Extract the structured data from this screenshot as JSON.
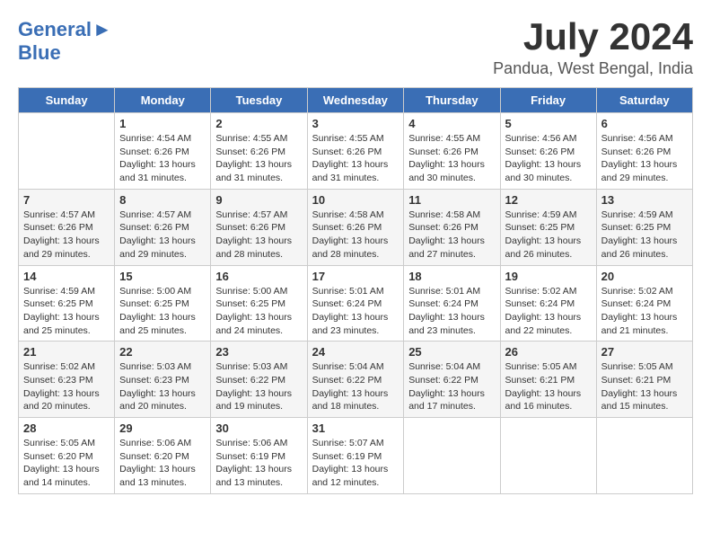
{
  "header": {
    "logo_general": "General",
    "logo_blue": "Blue",
    "month": "July 2024",
    "location": "Pandua, West Bengal, India"
  },
  "calendar": {
    "days_of_week": [
      "Sunday",
      "Monday",
      "Tuesday",
      "Wednesday",
      "Thursday",
      "Friday",
      "Saturday"
    ],
    "weeks": [
      [
        {
          "day": "",
          "info": ""
        },
        {
          "day": "1",
          "info": "Sunrise: 4:54 AM\nSunset: 6:26 PM\nDaylight: 13 hours\nand 31 minutes."
        },
        {
          "day": "2",
          "info": "Sunrise: 4:55 AM\nSunset: 6:26 PM\nDaylight: 13 hours\nand 31 minutes."
        },
        {
          "day": "3",
          "info": "Sunrise: 4:55 AM\nSunset: 6:26 PM\nDaylight: 13 hours\nand 31 minutes."
        },
        {
          "day": "4",
          "info": "Sunrise: 4:55 AM\nSunset: 6:26 PM\nDaylight: 13 hours\nand 30 minutes."
        },
        {
          "day": "5",
          "info": "Sunrise: 4:56 AM\nSunset: 6:26 PM\nDaylight: 13 hours\nand 30 minutes."
        },
        {
          "day": "6",
          "info": "Sunrise: 4:56 AM\nSunset: 6:26 PM\nDaylight: 13 hours\nand 29 minutes."
        }
      ],
      [
        {
          "day": "7",
          "info": "Sunrise: 4:57 AM\nSunset: 6:26 PM\nDaylight: 13 hours\nand 29 minutes."
        },
        {
          "day": "8",
          "info": "Sunrise: 4:57 AM\nSunset: 6:26 PM\nDaylight: 13 hours\nand 29 minutes."
        },
        {
          "day": "9",
          "info": "Sunrise: 4:57 AM\nSunset: 6:26 PM\nDaylight: 13 hours\nand 28 minutes."
        },
        {
          "day": "10",
          "info": "Sunrise: 4:58 AM\nSunset: 6:26 PM\nDaylight: 13 hours\nand 28 minutes."
        },
        {
          "day": "11",
          "info": "Sunrise: 4:58 AM\nSunset: 6:26 PM\nDaylight: 13 hours\nand 27 minutes."
        },
        {
          "day": "12",
          "info": "Sunrise: 4:59 AM\nSunset: 6:25 PM\nDaylight: 13 hours\nand 26 minutes."
        },
        {
          "day": "13",
          "info": "Sunrise: 4:59 AM\nSunset: 6:25 PM\nDaylight: 13 hours\nand 26 minutes."
        }
      ],
      [
        {
          "day": "14",
          "info": "Sunrise: 4:59 AM\nSunset: 6:25 PM\nDaylight: 13 hours\nand 25 minutes."
        },
        {
          "day": "15",
          "info": "Sunrise: 5:00 AM\nSunset: 6:25 PM\nDaylight: 13 hours\nand 25 minutes."
        },
        {
          "day": "16",
          "info": "Sunrise: 5:00 AM\nSunset: 6:25 PM\nDaylight: 13 hours\nand 24 minutes."
        },
        {
          "day": "17",
          "info": "Sunrise: 5:01 AM\nSunset: 6:24 PM\nDaylight: 13 hours\nand 23 minutes."
        },
        {
          "day": "18",
          "info": "Sunrise: 5:01 AM\nSunset: 6:24 PM\nDaylight: 13 hours\nand 23 minutes."
        },
        {
          "day": "19",
          "info": "Sunrise: 5:02 AM\nSunset: 6:24 PM\nDaylight: 13 hours\nand 22 minutes."
        },
        {
          "day": "20",
          "info": "Sunrise: 5:02 AM\nSunset: 6:24 PM\nDaylight: 13 hours\nand 21 minutes."
        }
      ],
      [
        {
          "day": "21",
          "info": "Sunrise: 5:02 AM\nSunset: 6:23 PM\nDaylight: 13 hours\nand 20 minutes."
        },
        {
          "day": "22",
          "info": "Sunrise: 5:03 AM\nSunset: 6:23 PM\nDaylight: 13 hours\nand 20 minutes."
        },
        {
          "day": "23",
          "info": "Sunrise: 5:03 AM\nSunset: 6:22 PM\nDaylight: 13 hours\nand 19 minutes."
        },
        {
          "day": "24",
          "info": "Sunrise: 5:04 AM\nSunset: 6:22 PM\nDaylight: 13 hours\nand 18 minutes."
        },
        {
          "day": "25",
          "info": "Sunrise: 5:04 AM\nSunset: 6:22 PM\nDaylight: 13 hours\nand 17 minutes."
        },
        {
          "day": "26",
          "info": "Sunrise: 5:05 AM\nSunset: 6:21 PM\nDaylight: 13 hours\nand 16 minutes."
        },
        {
          "day": "27",
          "info": "Sunrise: 5:05 AM\nSunset: 6:21 PM\nDaylight: 13 hours\nand 15 minutes."
        }
      ],
      [
        {
          "day": "28",
          "info": "Sunrise: 5:05 AM\nSunset: 6:20 PM\nDaylight: 13 hours\nand 14 minutes."
        },
        {
          "day": "29",
          "info": "Sunrise: 5:06 AM\nSunset: 6:20 PM\nDaylight: 13 hours\nand 13 minutes."
        },
        {
          "day": "30",
          "info": "Sunrise: 5:06 AM\nSunset: 6:19 PM\nDaylight: 13 hours\nand 13 minutes."
        },
        {
          "day": "31",
          "info": "Sunrise: 5:07 AM\nSunset: 6:19 PM\nDaylight: 13 hours\nand 12 minutes."
        },
        {
          "day": "",
          "info": ""
        },
        {
          "day": "",
          "info": ""
        },
        {
          "day": "",
          "info": ""
        }
      ]
    ]
  }
}
